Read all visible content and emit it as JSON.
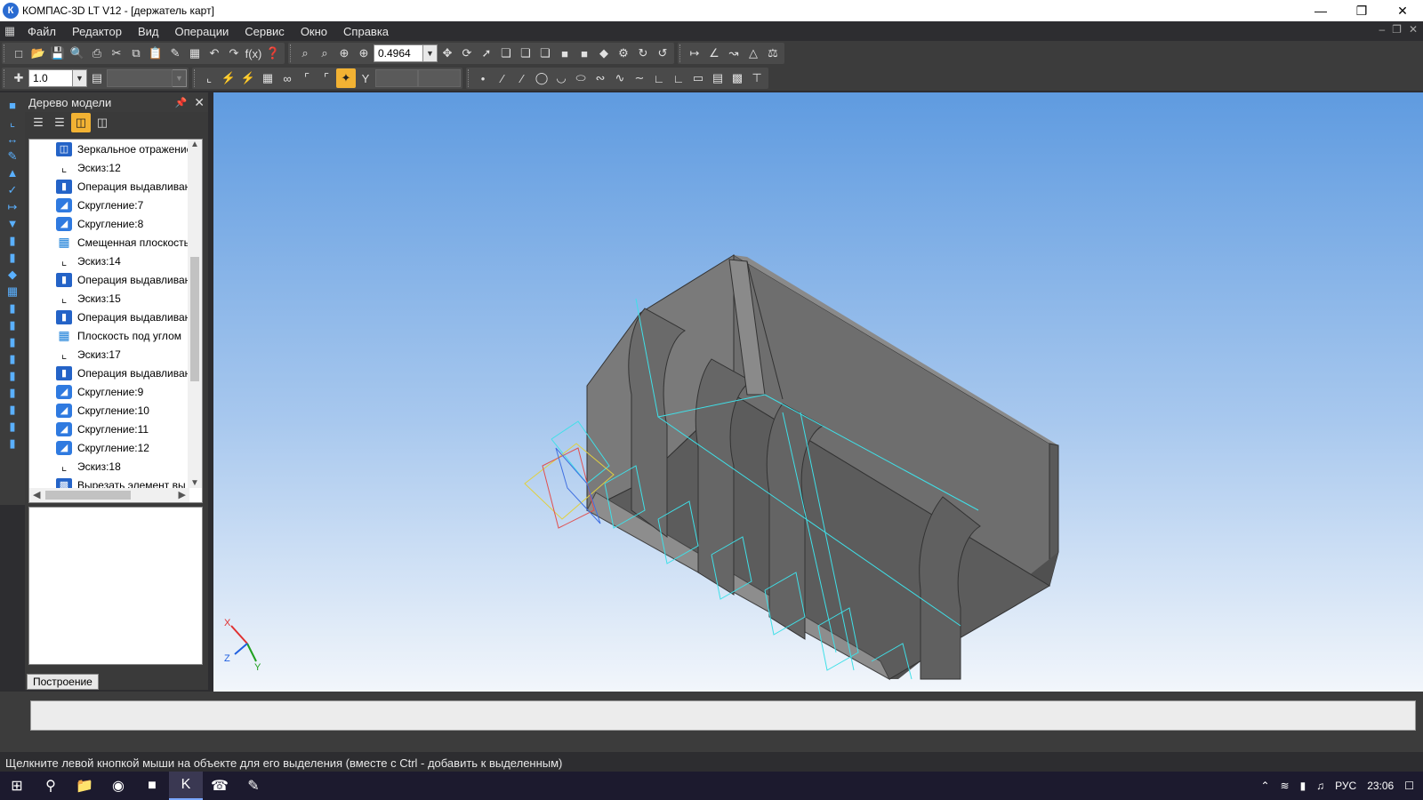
{
  "window": {
    "title": "КОМПАС-3D LT V12 - [держатель карт]",
    "app_icon": "К"
  },
  "menu": [
    "Файл",
    "Редактор",
    "Вид",
    "Операции",
    "Сервис",
    "Окно",
    "Справка"
  ],
  "toolbar": {
    "zoom_value": "0.4964",
    "step_value": "1.0"
  },
  "model_tree": {
    "title": "Дерево модели",
    "items": [
      {
        "label": "Зеркальное отражение",
        "icon": "mirror-icon"
      },
      {
        "label": "Эскиз:12",
        "icon": "sketch-icon"
      },
      {
        "label": "Операция выдавливания",
        "icon": "extrude-icon"
      },
      {
        "label": "Скругление:7",
        "icon": "fillet-icon"
      },
      {
        "label": "Скругление:8",
        "icon": "fillet-icon"
      },
      {
        "label": "Смещенная плоскость",
        "icon": "plane-icon"
      },
      {
        "label": "Эскиз:14",
        "icon": "sketch-icon"
      },
      {
        "label": "Операция выдавливания",
        "icon": "extrude-icon"
      },
      {
        "label": "Эскиз:15",
        "icon": "sketch-icon"
      },
      {
        "label": "Операция выдавливания",
        "icon": "extrude-icon"
      },
      {
        "label": "Плоскость под углом",
        "icon": "plane-icon"
      },
      {
        "label": "Эскиз:17",
        "icon": "sketch-icon"
      },
      {
        "label": "Операция выдавливания",
        "icon": "extrude-icon"
      },
      {
        "label": "Скругление:9",
        "icon": "fillet-icon"
      },
      {
        "label": "Скругление:10",
        "icon": "fillet-icon"
      },
      {
        "label": "Скругление:11",
        "icon": "fillet-icon"
      },
      {
        "label": "Скругление:12",
        "icon": "fillet-icon"
      },
      {
        "label": "Эскиз:18",
        "icon": "sketch-icon"
      },
      {
        "label": "Вырезать элемент вы",
        "icon": "cut-icon"
      }
    ],
    "tab": "Построение"
  },
  "axes": {
    "x": "X",
    "y": "Y",
    "z": "Z"
  },
  "status": "Щелкните левой кнопкой мыши на объекте для его выделения (вместе с Ctrl - добавить к выделенным)",
  "tray": {
    "lang": "РУС",
    "time": "23:06"
  }
}
